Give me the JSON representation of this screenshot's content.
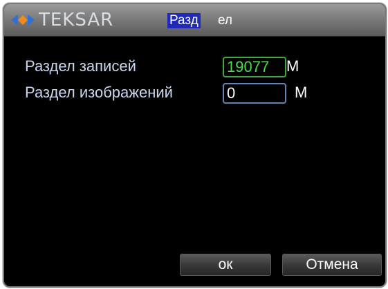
{
  "window": {
    "logo_text": "TEKSAR",
    "title_highlight": "Разд",
    "title_rest": "ел"
  },
  "form": {
    "record_partition_label": "Раздел записей",
    "record_partition_value": "19077",
    "record_partition_unit": "M",
    "image_partition_label": "Раздел изображений",
    "image_partition_value": "0",
    "image_partition_unit": "M"
  },
  "buttons": {
    "ok_label": "ок",
    "cancel_label": "Отмена"
  },
  "colors": {
    "title_highlight_bg": "#1f2bb8",
    "active_field_text": "#44e044",
    "label_text": "#c9d8ee"
  }
}
